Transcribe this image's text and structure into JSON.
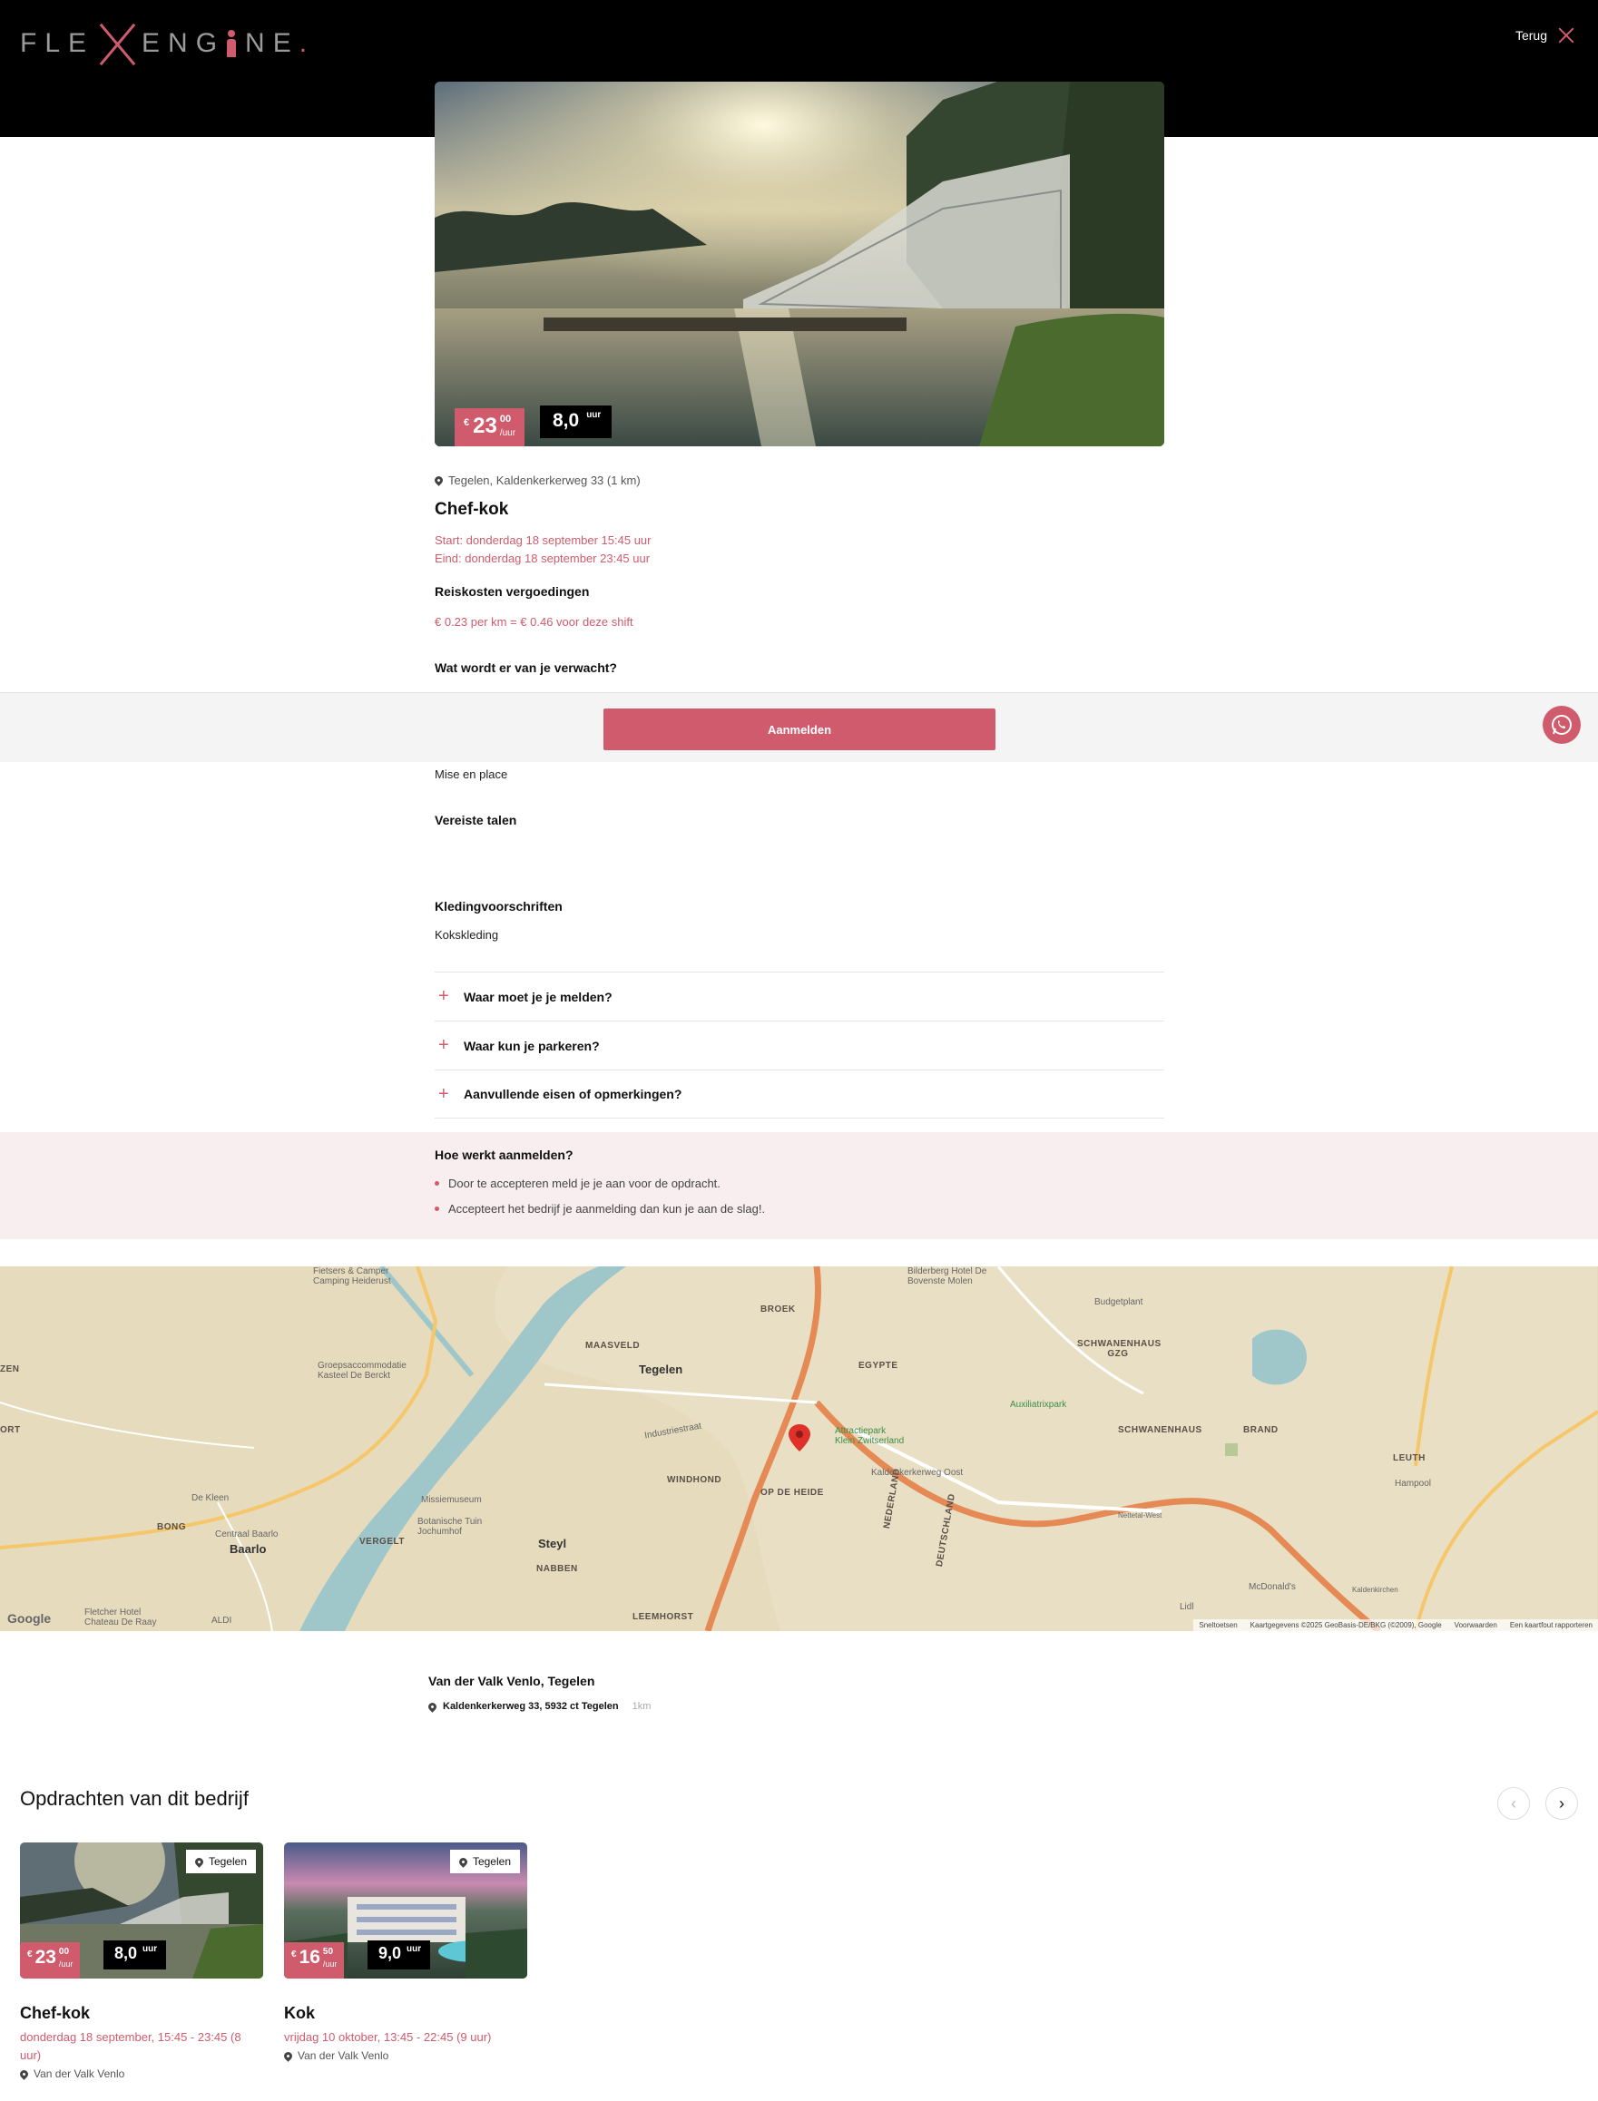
{
  "header": {
    "logo_left": "FLE",
    "logo_right": "ENG",
    "logo_tail": "NE",
    "logo_dot": ".",
    "back_label": "Terug"
  },
  "job": {
    "price_whole": "23",
    "price_cents": "00",
    "price_unit": "/uur",
    "currency": "€",
    "hours": "8,0",
    "hours_unit": "uur",
    "location": "Tegelen, Kaldenkerkerweg 33 (1 km)",
    "title": "Chef-kok",
    "start": "Start: donderdag 18 september 15:45 uur",
    "end": "Eind: donderdag 18 september 23:45 uur",
    "travel_heading": "Reiskosten vergoedingen",
    "travel_text": "€ 0.23 per km = € 0.46 voor deze shift",
    "expect_heading": "Wat wordt er van je verwacht?",
    "expect_text": "Mise en place",
    "languages_heading": "Vereiste talen",
    "dress_heading": "Kledingvoorschriften",
    "dress_text": "Kokskleding"
  },
  "apply": {
    "label": "Aanmelden"
  },
  "accordion": [
    {
      "label": "Waar moet je je melden?"
    },
    {
      "label": "Waar kun je parkeren?"
    },
    {
      "label": "Aanvullende eisen of opmerkingen?"
    }
  ],
  "how": {
    "heading": "Hoe werkt aanmelden?",
    "items": [
      "Door te accepteren meld je je aan voor de opdracht.",
      "Accepteert het bedrijf je aanmelding dan kun je aan de slag!."
    ]
  },
  "map": {
    "labels": {
      "broek": "BROEK",
      "maasveld": "MAASVELD",
      "tegelen": "Tegelen",
      "egypte": "EGYPTE",
      "schwanenhaus_gzg": "SCHWANENHAUS GZG",
      "schwanenhaus": "SCHWANENHAUS",
      "brand": "BRAND",
      "leuth": "LEUTH",
      "hampool": "Hampool",
      "windhond": "WINDHOND",
      "op_de_heide": "OP DE HEIDE",
      "bong": "BONG",
      "baarlo": "Baarlo",
      "vergelt": "VERGELT",
      "steyl": "Steyl",
      "nabben": "NABBEN",
      "leemhorst": "LEEMHORST",
      "nederland": "NEDERLAND",
      "deutschland": "DEUTSCHLAND",
      "zen": "ZEN",
      "ort": "ORT"
    },
    "pois": {
      "fietsers": "Fietsers & Camper Camping Heiderust",
      "bilderberg": "Bilderberg Hotel De Bovenste Molen",
      "budgetplant": "Budgetplant",
      "groeps": "Groepsaccommodatie Kasteel De Berckt",
      "auxilia": "Auxiliatrixpark",
      "klein_zw": "Attractiepark Klein Zwitserland",
      "kaldenkerkerweg_oost": "Kaldenkerkerweg Oost",
      "de_kleen": "De Kleen",
      "missiemuseum": "Missiemuseum",
      "botanische": "Botanische Tuin Jochumhof",
      "centraal_baarlo": "Centraal Baarlo",
      "fletcher": "Fletcher Hotel Chateau De Raay",
      "aldi": "ALDI",
      "mcdonalds": "McDonald's",
      "lidl": "Lidl",
      "industriestraat": "Industriestraat",
      "kaldenkirchen": "Kaldenkirchen",
      "nettetal_west": "Nettetal-West",
      "google": "Google"
    },
    "attribution": [
      "Sneltoetsen",
      "Kaartgegevens ©2025 GeoBasis-DE/BKG (©2009), Google",
      "Voorwaarden",
      "Een kaartfout rapporteren"
    ]
  },
  "venue": {
    "name": "Van der Valk Venlo, Tegelen",
    "address": "Kaldenkerkerweg 33, 5932 ct Tegelen",
    "distance": "1km"
  },
  "company_jobs": {
    "title": "Opdrachten van dit bedrijf",
    "cards": [
      {
        "city": "Tegelen",
        "currency": "€",
        "price_whole": "23",
        "price_cents": "00",
        "price_unit": "/uur",
        "hours": "8,0",
        "hours_unit": "uur",
        "title": "Chef-kok",
        "date": "donderdag 18 september, 15:45 - 23:45 (8 uur)",
        "company": "Van der Valk Venlo"
      },
      {
        "city": "Tegelen",
        "currency": "€",
        "price_whole": "16",
        "price_cents": "50",
        "price_unit": "/uur",
        "hours": "9,0",
        "hours_unit": "uur",
        "title": "Kok",
        "date": "vrijdag 10 oktober, 13:45 - 22:45 (9 uur)",
        "company": "Van der Valk Venlo"
      }
    ]
  }
}
